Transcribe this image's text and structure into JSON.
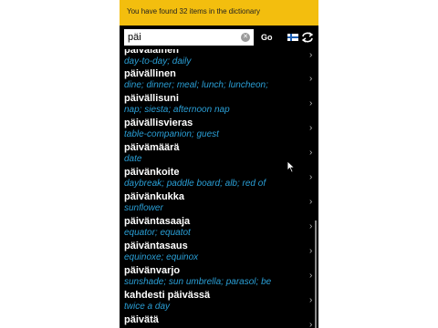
{
  "banner": {
    "message": "You have found 32 items in the dictionary"
  },
  "search": {
    "value": "päi",
    "go_label": "Go"
  },
  "icons": {
    "clear": "clear-icon",
    "flag": "finnish-flag-icon",
    "swap": "swap-languages-icon",
    "chevron": "chevron-right-icon"
  },
  "colors": {
    "banner": "#f3be0e",
    "translation": "#2a9fd6",
    "background": "#000000"
  },
  "results": [
    {
      "headword": "päivälainen",
      "translation": "day-to-day; daily"
    },
    {
      "headword": "päivällinen",
      "translation": "dine; dinner; meal; lunch; luncheon;"
    },
    {
      "headword": "päivällisuni",
      "translation": "nap; siesta; afternoon nap"
    },
    {
      "headword": "päivällisvieras",
      "translation": "table-companion; guest"
    },
    {
      "headword": "päivämäärä",
      "translation": "date"
    },
    {
      "headword": "päivänkoite",
      "translation": "daybreak; paddle board; alb; red of"
    },
    {
      "headword": "päivänkukka",
      "translation": "sunflower"
    },
    {
      "headword": "päiväntasaaja",
      "translation": "equator; equatot"
    },
    {
      "headword": "päiväntasaus",
      "translation": "equinoxe; equinox"
    },
    {
      "headword": "päivänvarjo",
      "translation": "sunshade; sun umbrella; parasol; be"
    },
    {
      "headword": "kahdesti päivässä",
      "translation": "twice a day"
    },
    {
      "headword": "päivätä",
      "translation": ""
    }
  ]
}
